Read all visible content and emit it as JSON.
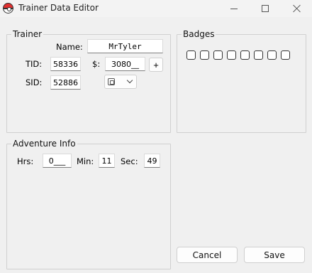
{
  "window": {
    "title": "Trainer Data Editor",
    "icon": "pokeball-icon"
  },
  "trainer": {
    "group_label": "Trainer",
    "name_label": "Name:",
    "name_value": "MrTyler",
    "tid_label": "TID:",
    "tid_value": "58336",
    "money_label": "$:",
    "money_value": "3080__",
    "add_label": "+",
    "sid_label": "SID:",
    "sid_value": "52886",
    "game_combo_icon": "game-version-icon"
  },
  "badges": {
    "group_label": "Badges",
    "items": [
      {
        "checked": false
      },
      {
        "checked": false
      },
      {
        "checked": false
      },
      {
        "checked": false
      },
      {
        "checked": false
      },
      {
        "checked": false
      },
      {
        "checked": false
      },
      {
        "checked": false
      }
    ]
  },
  "adventure": {
    "group_label": "Adventure Info",
    "hrs_label": "Hrs:",
    "hrs_value": "0___",
    "min_label": "Min:",
    "min_value": "11",
    "sec_label": "Sec:",
    "sec_value": "49"
  },
  "actions": {
    "cancel_label": "Cancel",
    "save_label": "Save"
  }
}
